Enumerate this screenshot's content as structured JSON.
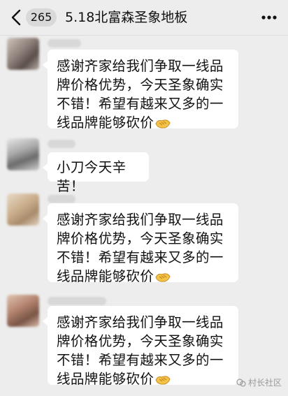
{
  "header": {
    "unread_count": "265",
    "title": "5.18北富森圣象地板"
  },
  "messages": [
    {
      "text": "感谢齐家给我们争取一线品牌价格优势，今天圣象确实不错！希望有越来又多的一线品牌能够砍价",
      "emoji": "handshake-emoji"
    },
    {
      "text": "小刀今天辛苦！",
      "emoji": ""
    },
    {
      "text": "感谢齐家给我们争取一线品牌价格优势，今天圣象确实不错！希望有越来又多的一线品牌能够砍价",
      "emoji": "handshake-emoji"
    },
    {
      "text": "感谢齐家给我们争取一线品牌价格优势，今天圣象确实不错！希望有越来又多的一线品牌能够砍价",
      "emoji": "handshake-emoji"
    }
  ],
  "watermark": {
    "text": "村长社区",
    "icon": "wechat-channel-icon"
  },
  "colors": {
    "background": "#ededed",
    "bubble": "#ffffff",
    "text": "#111111"
  }
}
